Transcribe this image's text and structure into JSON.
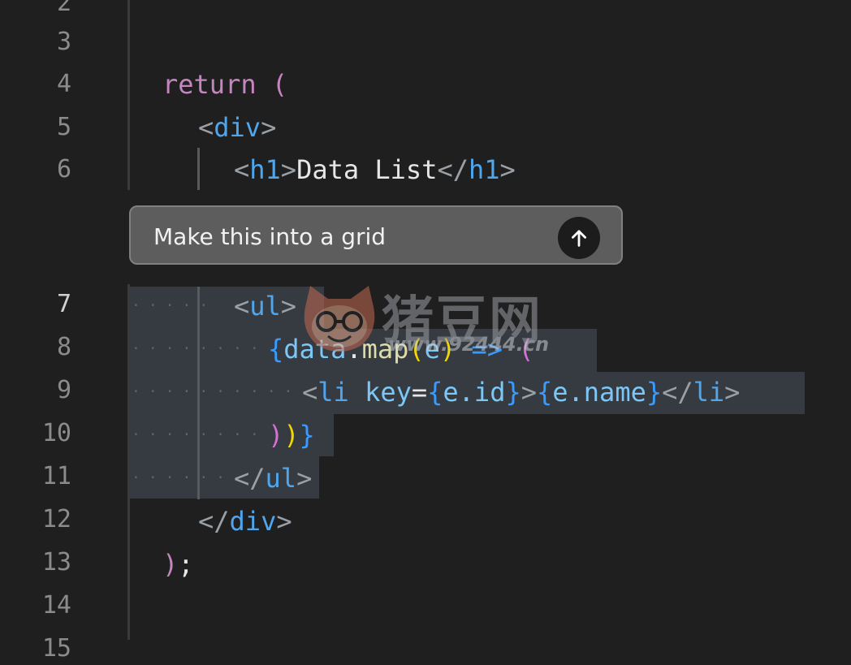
{
  "editor": {
    "line_numbers": [
      "2",
      "3",
      "4",
      "5",
      "6",
      "7",
      "8",
      "9",
      "10",
      "11",
      "12",
      "13",
      "14",
      "15"
    ],
    "code": {
      "l4": {
        "kw": "return",
        "paren": "("
      },
      "l5": {
        "open": "<",
        "tag": "div",
        "close": ">"
      },
      "l6": {
        "open": "<",
        "tag": "h1",
        "close": ">",
        "text": "Data List",
        "end_open": "</",
        "end_tag": "h1",
        "end_close": ">"
      },
      "l7": {
        "open": "<",
        "tag": "ul",
        "close": ">"
      },
      "l8": {
        "brace": "{",
        "obj": "data",
        "dot": ".",
        "fn": "map",
        "lp": "(",
        "arg": "e",
        "rp": ")",
        "arrow": "=>",
        "paren": "("
      },
      "l9": {
        "open": "<",
        "tag": "li",
        "attr": "key",
        "eq": "=",
        "lb1": "{",
        "expr1": "e.id",
        "rb1": "}",
        "close": ">",
        "lb2": "{",
        "expr2": "e.name",
        "rb2": "}",
        "end_open": "</",
        "end_tag": "li",
        "end_close": ">"
      },
      "l10": {
        "p1": ")",
        "p2": ")",
        "brace": "}"
      },
      "l11": {
        "end_open": "</",
        "end_tag": "ul",
        "end_close": ">"
      },
      "l12": {
        "end_open": "</",
        "end_tag": "div",
        "end_close": ">"
      },
      "l13": {
        "paren": ")",
        "semi": ";"
      }
    }
  },
  "prompt": {
    "text": "Make this into a grid",
    "send_icon": "arrow-up-icon"
  },
  "watermark": {
    "title": "猪豆网",
    "url": "www.92444.cn"
  },
  "colors": {
    "background": "#1f1f1f",
    "selection": "#363b42",
    "keyword": "#c586c0",
    "tag": "#4fa6ed",
    "variable": "#7cc7f5",
    "function": "#dcdcaa"
  }
}
